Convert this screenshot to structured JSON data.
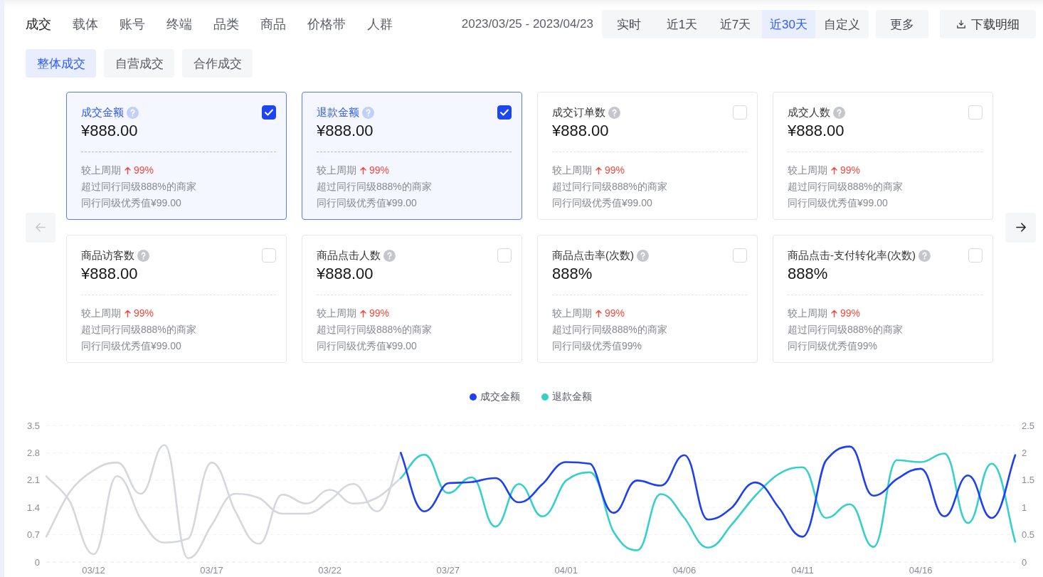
{
  "tabs": [
    {
      "label": "成交",
      "selected": true
    },
    {
      "label": "载体",
      "selected": false
    },
    {
      "label": "账号",
      "selected": false
    },
    {
      "label": "终端",
      "selected": false
    },
    {
      "label": "品类",
      "selected": false
    },
    {
      "label": "商品",
      "selected": false
    },
    {
      "label": "价格带",
      "selected": false
    },
    {
      "label": "人群",
      "selected": false
    }
  ],
  "date_range": "2023/03/25 - 2023/04/23",
  "time_ranges": [
    {
      "label": "实时",
      "selected": false
    },
    {
      "label": "近1天",
      "selected": false
    },
    {
      "label": "近7天",
      "selected": false
    },
    {
      "label": "近30天",
      "selected": true
    },
    {
      "label": "自定义",
      "selected": false
    }
  ],
  "more_button": "更多",
  "download_button": "下载明细",
  "scope_tabs": [
    {
      "label": "整体成交",
      "selected": true
    },
    {
      "label": "自营成交",
      "selected": false
    },
    {
      "label": "合作成交",
      "selected": false
    }
  ],
  "carousel": {
    "prev": {
      "disabled": true
    },
    "next": {
      "disabled": false
    }
  },
  "metric_cards": [
    {
      "title": "成交金额",
      "checked": true,
      "value": "¥888.00",
      "compare_label": "较上周期",
      "trend_up": true,
      "change": "99%",
      "rank_text": "超过同行同级888%的商家",
      "benchmark_text": "同行同级优秀值¥99.00"
    },
    {
      "title": "退款金额",
      "checked": true,
      "value": "¥888.00",
      "compare_label": "较上周期",
      "trend_up": true,
      "change": "99%",
      "rank_text": "超过同行同级888%的商家",
      "benchmark_text": "同行同级优秀值¥99.00"
    },
    {
      "title": "成交订单数",
      "checked": false,
      "value": "¥888.00",
      "compare_label": "较上周期",
      "trend_up": true,
      "change": "99%",
      "rank_text": "超过同行同级888%的商家",
      "benchmark_text": "同行同级优秀值¥99.00"
    },
    {
      "title": "成交人数",
      "checked": false,
      "value": "¥888.00",
      "compare_label": "较上周期",
      "trend_up": true,
      "change": "99%",
      "rank_text": "超过同行同级888%的商家",
      "benchmark_text": "同行同级优秀值¥99.00"
    },
    {
      "title": "商品访客数",
      "checked": false,
      "value": "¥888.00",
      "compare_label": "较上周期",
      "trend_up": true,
      "change": "99%",
      "rank_text": "超过同行同级888%的商家",
      "benchmark_text": "同行同级优秀值¥99.00"
    },
    {
      "title": "商品点击人数",
      "checked": false,
      "value": "¥888.00",
      "compare_label": "较上周期",
      "trend_up": true,
      "change": "99%",
      "rank_text": "超过同行同级888%的商家",
      "benchmark_text": "同行同级优秀值¥99.00"
    },
    {
      "title": "商品点击率(次数)",
      "checked": false,
      "value": "888%",
      "compare_label": "较上周期",
      "trend_up": true,
      "change": "99%",
      "rank_text": "超过同行同级888%的商家",
      "benchmark_text": "同行同级优秀值99%"
    },
    {
      "title": "商品点击-支付转化率(次数)",
      "checked": false,
      "value": "888%",
      "compare_label": "较上周期",
      "trend_up": true,
      "change": "99%",
      "rank_text": "超过同行同级888%的商家",
      "benchmark_text": "同行同级优秀值99%"
    }
  ],
  "chart": {
    "right_axis_ticks": [
      "2.5",
      "2",
      "1.5",
      "1",
      "0.5",
      "0"
    ],
    "chart_data": {
      "type": "line",
      "grid": true,
      "categories": [
        null,
        null,
        "03/12",
        null,
        null,
        null,
        null,
        "03/17",
        null,
        null,
        null,
        null,
        "03/22",
        null,
        null,
        null,
        null,
        "03/27",
        null,
        null,
        null,
        null,
        "04/01",
        null,
        null,
        null,
        null,
        "04/06",
        null,
        null,
        null,
        null,
        "04/11",
        null,
        null,
        null,
        null,
        "04/16",
        null,
        null,
        null,
        null
      ],
      "ylim": [
        0,
        3.5
      ],
      "yticks": [
        3.5,
        2.8,
        2.1,
        1.4,
        0.7,
        0
      ],
      "series": [
        {
          "name": "成交金额",
          "color": "#1f3ff2",
          "values": [
            null,
            null,
            null,
            null,
            null,
            null,
            null,
            null,
            null,
            null,
            null,
            null,
            null,
            null,
            null,
            2.8,
            1.3,
            2.02,
            2.05,
            2.15,
            1.53,
            2.0,
            2.56,
            2.52,
            1.26,
            2.09,
            1.96,
            2.74,
            1.09,
            1.39,
            2.04,
            1.39,
            0.65,
            2.61,
            2.96,
            1.7,
            2.13,
            2.39,
            1.17,
            2.22,
            1.13,
            2.74
          ]
        },
        {
          "name": "退款金额",
          "color": "#36d0cb",
          "values": [
            null,
            null,
            null,
            null,
            null,
            null,
            null,
            null,
            null,
            null,
            null,
            null,
            null,
            null,
            null,
            2.15,
            2.75,
            1.77,
            2.17,
            0.91,
            2.0,
            1.17,
            2.09,
            2.3,
            0.78,
            0.3,
            1.74,
            1.13,
            0.37,
            0.96,
            1.7,
            2.26,
            2.43,
            1.13,
            1.48,
            0.39,
            2.61,
            2.56,
            2.78,
            1.0,
            2.52,
            0.52
          ]
        },
        {
          "color": "#d5d7dc",
          "values": [
            0.65,
            1.8,
            2.35,
            2.55,
            1.75,
            3.0,
            0.1,
            0.95,
            1.75,
            1.64,
            1.24,
            1.24,
            1.58,
            2.0,
            1.3,
            2.8,
            null,
            null,
            null,
            null,
            null,
            null,
            null,
            null,
            null,
            null,
            null,
            null,
            null,
            null,
            null,
            null,
            null,
            null,
            null,
            null,
            null,
            null,
            null,
            null,
            null,
            null
          ]
        },
        {
          "color": "#d5d7dc",
          "values": [
            2.2,
            1.55,
            0.2,
            2.2,
            1.1,
            0.5,
            0.6,
            2.55,
            1.3,
            0.47,
            1.73,
            1.5,
            1.85,
            1.5,
            1.65,
            2.15,
            null,
            null,
            null,
            null,
            null,
            null,
            null,
            null,
            null,
            null,
            null,
            null,
            null,
            null,
            null,
            null,
            null,
            null,
            null,
            null,
            null,
            null,
            null,
            null,
            null,
            null
          ]
        }
      ]
    }
  }
}
